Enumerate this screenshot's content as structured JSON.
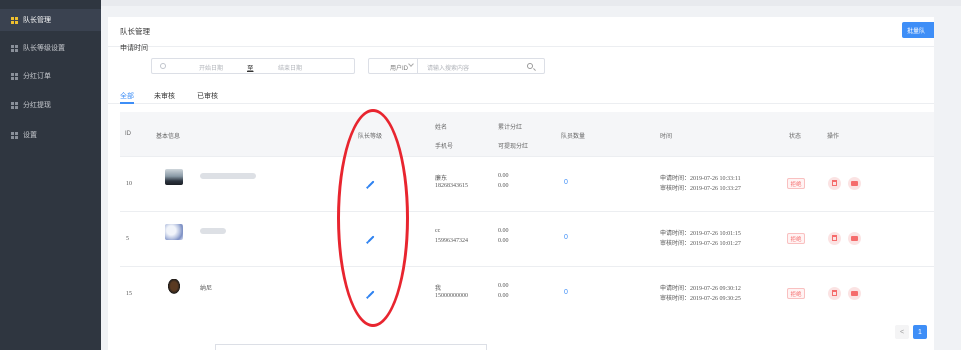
{
  "sidebar": {
    "items": [
      {
        "label": "队长管理",
        "active": true
      },
      {
        "label": "队长等级设置",
        "active": false
      },
      {
        "label": "分红订单",
        "active": false
      },
      {
        "label": "分红提现",
        "active": false
      },
      {
        "label": "设置",
        "active": false
      }
    ]
  },
  "header": {
    "title": "队长管理",
    "add_button": "批量队"
  },
  "filter": {
    "label": "申请时间",
    "date_start_placeholder": "开始日期",
    "date_separator": "至",
    "date_end_placeholder": "结束日期",
    "select_value": "用户ID",
    "search_placeholder": "请输入搜索内容"
  },
  "tabs": [
    "全部",
    "未审核",
    "已审核"
  ],
  "table": {
    "headers": {
      "id": "ID",
      "basic_info": "基本信息",
      "level": "队长等级",
      "name": "姓名",
      "phone": "手机号",
      "total_dividend": "累计分红",
      "withdrawable": "可提现分红",
      "members": "队员数量",
      "time": "时间",
      "status": "状态",
      "actions": "操作"
    },
    "rows": [
      {
        "id": "10",
        "nickname": "",
        "name": "廉东",
        "phone": "18268343615",
        "total": "0.00",
        "withdrawable": "0.00",
        "members": "0",
        "apply_time": "申请时间：2019-07-26 10:33:11",
        "audit_time": "审核时间：2019-07-26 10:33:27",
        "status": "拒绝"
      },
      {
        "id": "5",
        "nickname": "",
        "name": "cc",
        "phone": "15996347324",
        "total": "0.00",
        "withdrawable": "0.00",
        "members": "0",
        "apply_time": "申请时间：2019-07-26 10:01:15",
        "audit_time": "审核时间：2019-07-26 10:01:27",
        "status": "拒绝"
      },
      {
        "id": "15",
        "nickname": "纳尼",
        "name": "我",
        "phone": "15000000000",
        "total": "0.00",
        "withdrawable": "0.00",
        "members": "0",
        "apply_time": "申请时间：2019-07-26 09:30:12",
        "audit_time": "审核时间：2019-07-26 09:30:25",
        "status": "拒绝"
      }
    ]
  },
  "pagination": {
    "prev": "<",
    "current": "1"
  },
  "colors": {
    "accent": "#3e8ef7",
    "sidebar_bg": "#2f3640",
    "annotation": "#e8252f",
    "danger": "#f56c6c"
  }
}
